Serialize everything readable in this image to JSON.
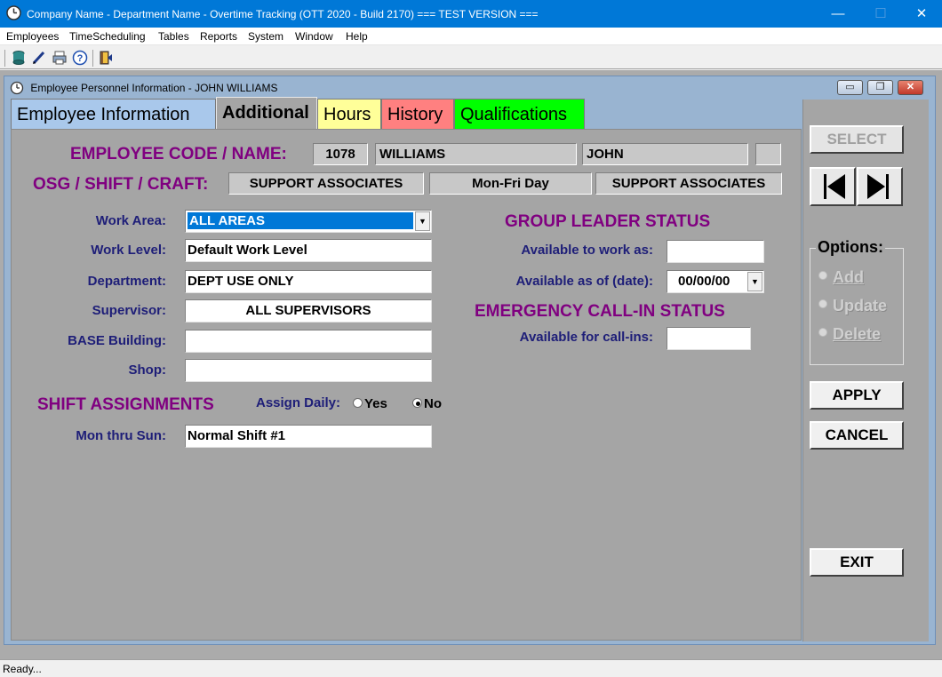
{
  "app": {
    "title": "Company Name - Department Name - Overtime Tracking (OTT 2020 - Build 2170) === TEST VERSION ===",
    "controls": {
      "minimize": "—",
      "maximize": "☐",
      "close": "✕"
    }
  },
  "menu": [
    "Employees",
    "TimeScheduling",
    "Tables",
    "Reports",
    "System",
    "Window",
    "Help"
  ],
  "toolbar": {
    "icons": [
      "database-icon",
      "edit-pen-icon",
      "printer-icon",
      "help-icon",
      "exit-door-icon"
    ]
  },
  "window": {
    "title": "Employee Personnel Information - JOHN WILLIAMS",
    "controls": {
      "minimize": "▭",
      "restore": "❐",
      "close": "✕"
    }
  },
  "tabs": [
    {
      "label": "Employee Information",
      "color": "#a9c8eb",
      "active": false
    },
    {
      "label": "Additional",
      "color": "#a5a5a5",
      "active": true
    },
    {
      "label": "Hours",
      "color": "#ffff99",
      "active": false
    },
    {
      "label": "History",
      "color": "#ff8080",
      "active": false
    },
    {
      "label": "Qualifications",
      "color": "#00ff00",
      "active": false
    }
  ],
  "employee": {
    "code_label": "EMPLOYEE CODE / NAME:",
    "code": "1078",
    "last_name": "WILLIAMS",
    "first_name": "JOHN",
    "suffix": "",
    "osg_label": "OSG / SHIFT / CRAFT:",
    "osg": "SUPPORT ASSOCIATES",
    "shift": "Mon-Fri Day",
    "craft": "SUPPORT ASSOCIATES"
  },
  "form": {
    "work_area_label": "Work Area:",
    "work_area": "ALL AREAS",
    "work_level_label": "Work Level:",
    "work_level": "Default Work Level",
    "department_label": "Department:",
    "department": "DEPT USE ONLY",
    "supervisor_label": "Supervisor:",
    "supervisor": "ALL SUPERVISORS",
    "base_building_label": "BASE Building:",
    "base_building": "",
    "shop_label": "Shop:",
    "shop": ""
  },
  "group_leader": {
    "heading": "GROUP LEADER STATUS",
    "available_as_label": "Available to work as:",
    "available_as": "",
    "available_date_label": "Available as of (date):",
    "available_date": "00/00/00"
  },
  "emergency": {
    "heading": "EMERGENCY CALL-IN STATUS",
    "available_label": "Available for call-ins:",
    "available": ""
  },
  "shift_assignments": {
    "heading": "SHIFT ASSIGNMENTS",
    "assign_daily_label": "Assign Daily:",
    "yes_label": "Yes",
    "no_label": "No",
    "selected": "No",
    "mon_sun_label": "Mon  thru  Sun:",
    "mon_sun": "Normal Shift #1"
  },
  "side": {
    "select_label": "SELECT",
    "options_title": "Options:",
    "options": [
      "Add",
      "Update",
      "Delete"
    ],
    "apply_label": "APPLY",
    "cancel_label": "CANCEL",
    "exit_label": "EXIT"
  },
  "status": "Ready..."
}
